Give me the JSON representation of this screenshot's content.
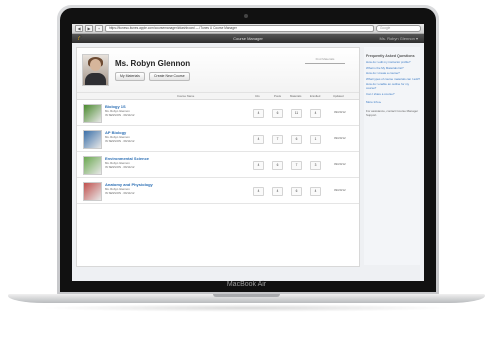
{
  "device": {
    "brand": "MacBook Air"
  },
  "browser": {
    "url": "https://itunesu.itunes.apple.com/coursemanager/#dashboard — iTunes U Course Manager",
    "search_placeholder": "Google",
    "back": "◀",
    "forward": "▶",
    "add": "+"
  },
  "app": {
    "title": "Course Manager",
    "user": "Ms. Robyn Glennon ▾",
    "logo_icon": "graduation-cap-icon"
  },
  "profile": {
    "name": "Ms. Robyn Glennon",
    "buttons": [
      "My Materials",
      "Create New Course"
    ],
    "search_label": "Find Materials"
  },
  "table": {
    "headers": {
      "course": "Course Name",
      "info": "Info",
      "posts": "Posts",
      "materials": "Materials",
      "enrolled": "Enrolled",
      "updated": "Updated"
    },
    "rows": [
      {
        "title": "Biology 1S",
        "teacher": "Ms. Robyn Glennon",
        "status": "IN SESSION · 09/14/12",
        "info": "4",
        "posts": "6",
        "materials": "11",
        "enrolled": "4",
        "updated": "09/20/12",
        "thumb_color": "#4a8a2e"
      },
      {
        "title": "AP Biology",
        "teacher": "Ms. Robyn Glennon",
        "status": "IN SESSION · 09/14/12",
        "info": "4",
        "posts": "7",
        "materials": "6",
        "enrolled": "1",
        "updated": "09/20/12",
        "thumb_color": "#3a6fa8"
      },
      {
        "title": "Environmental Science",
        "teacher": "Ms. Robyn Glennon",
        "status": "IN SESSION · 09/14/12",
        "info": "4",
        "posts": "6",
        "materials": "7",
        "enrolled": "3",
        "updated": "09/20/12",
        "thumb_color": "#6aa84f"
      },
      {
        "title": "Anatomy and Physiology",
        "teacher": "Ms. Robyn Glennon",
        "status": "IN SESSION · 09/14/12",
        "info": "4",
        "posts": "4",
        "materials": "6",
        "enrolled": "4",
        "updated": "09/20/12",
        "thumb_color": "#c0504d"
      }
    ]
  },
  "sidebar": {
    "heading": "Frequently Asked Questions",
    "questions": [
      "How do I edit my instructor profile?",
      "What is the My Materials list?",
      "How do I create a course?",
      "What types of course materials can I add?",
      "How do I enable an outline for my course?",
      "Can I share a course?"
    ],
    "more": "More Info ▸",
    "note": "For assistance, contact Course Manager Support."
  }
}
